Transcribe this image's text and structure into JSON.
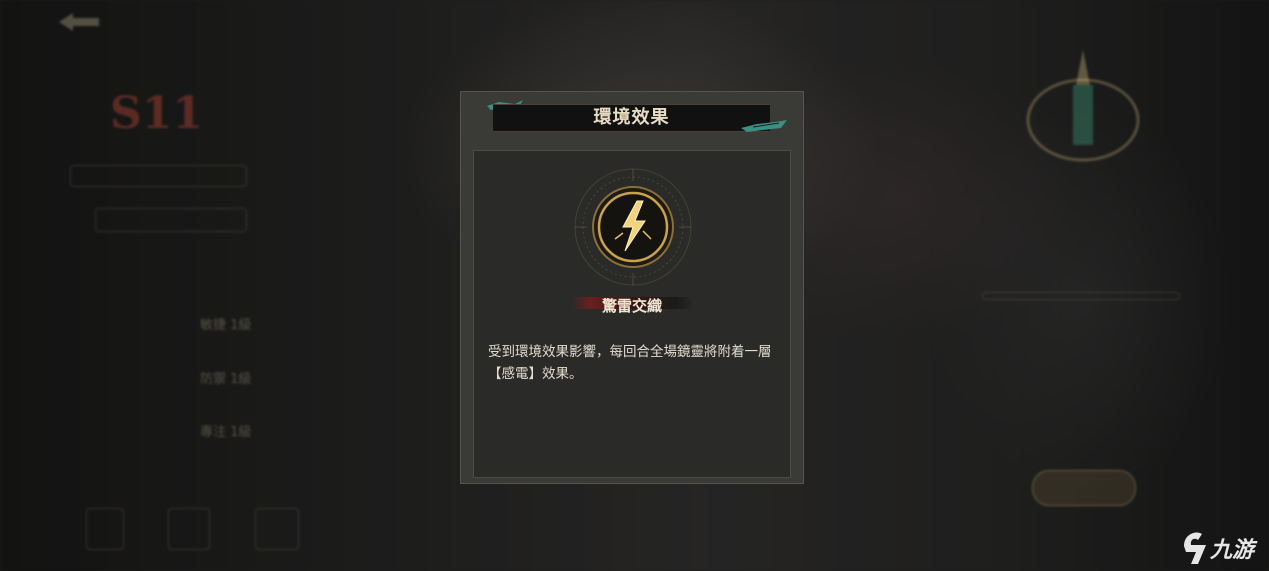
{
  "background": {
    "score": "S11",
    "menu_items": [
      "敏捷 1級",
      "防禦 1級",
      "專注 1級"
    ]
  },
  "dialog": {
    "title": "環境效果",
    "effect_name": "驚雷交織",
    "description": "受到環境效果影響，每回合全場鏡靈將附着一層【感電】效果。",
    "icon": "lightning-bolt-icon",
    "accent_color": "#c9a24a"
  },
  "watermark": {
    "text": "九游"
  }
}
